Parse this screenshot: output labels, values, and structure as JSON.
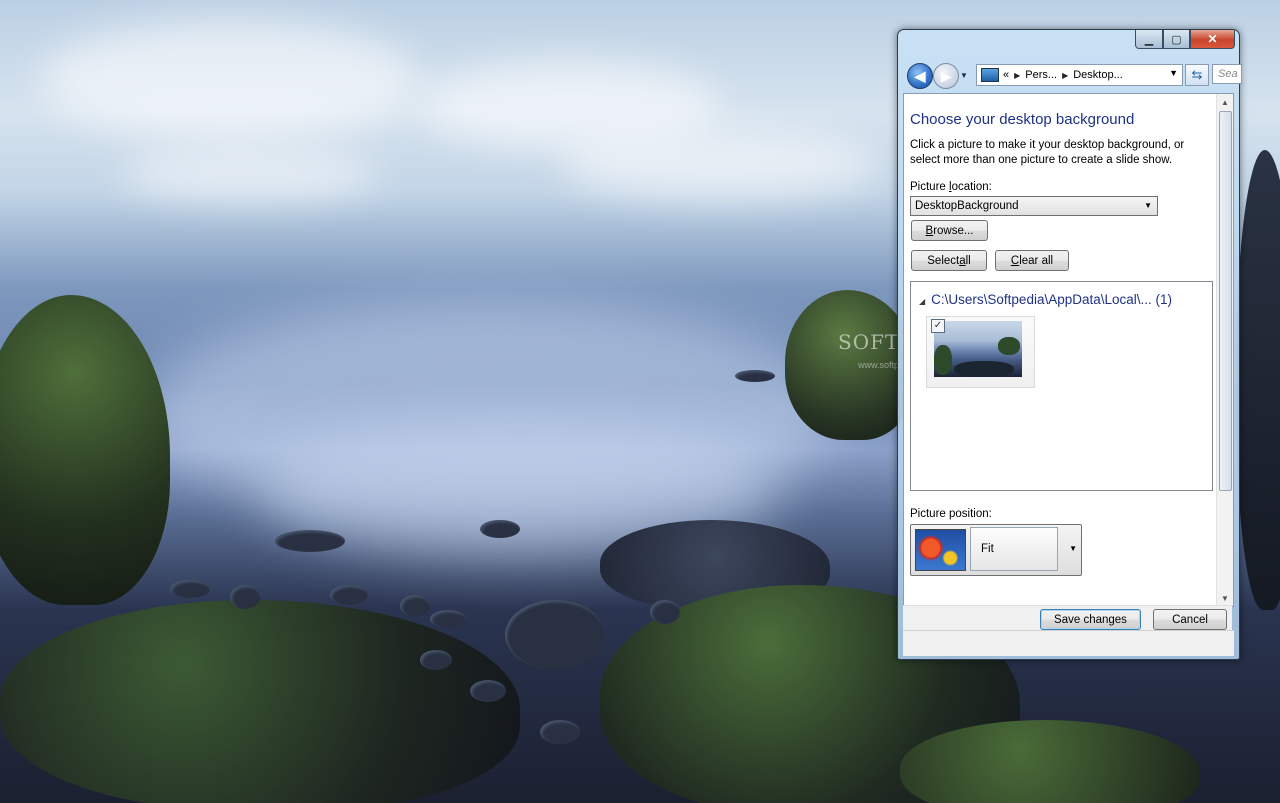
{
  "watermark": {
    "brand": "SOFTPEDIA",
    "url": "www.softpedia.com"
  },
  "window": {
    "caption_buttons": {
      "minimize": "▁",
      "maximize": "▢",
      "close": "✕"
    },
    "nav": {
      "back_icon": "back-arrow-icon",
      "forward_icon": "forward-arrow-icon",
      "address": {
        "overflow": "«",
        "segments": [
          "Pers...",
          "Desktop..."
        ]
      },
      "search_placeholder": "Sea"
    },
    "content": {
      "title": "Choose your desktop background",
      "description": "Click a picture to make it your desktop background, or select more than one picture to create a slide show.",
      "picture_location": {
        "label_prefix": "Picture ",
        "label_accel": "l",
        "label_suffix": "ocation:",
        "selected": "DesktopBackground"
      },
      "browse": {
        "accel": "B",
        "rest": "rowse..."
      },
      "select_all": {
        "prefix": "Select ",
        "accel": "a",
        "suffix": "ll"
      },
      "clear_all": {
        "prefix": "",
        "accel": "C",
        "suffix": "lear all"
      },
      "gallery": {
        "group_path": "C:\\Users\\Softpedia\\AppData\\Local\\...",
        "group_count": "(1)",
        "items": [
          {
            "checked": "✓"
          }
        ]
      },
      "picture_position": {
        "label": "Picture position:",
        "selected": "Fit"
      }
    },
    "footer": {
      "save": "Save changes",
      "cancel": "Cancel"
    }
  },
  "colors": {
    "title_blue": "#1e3287",
    "accent": "#1f5fa7",
    "close_red": "#c7452c"
  }
}
